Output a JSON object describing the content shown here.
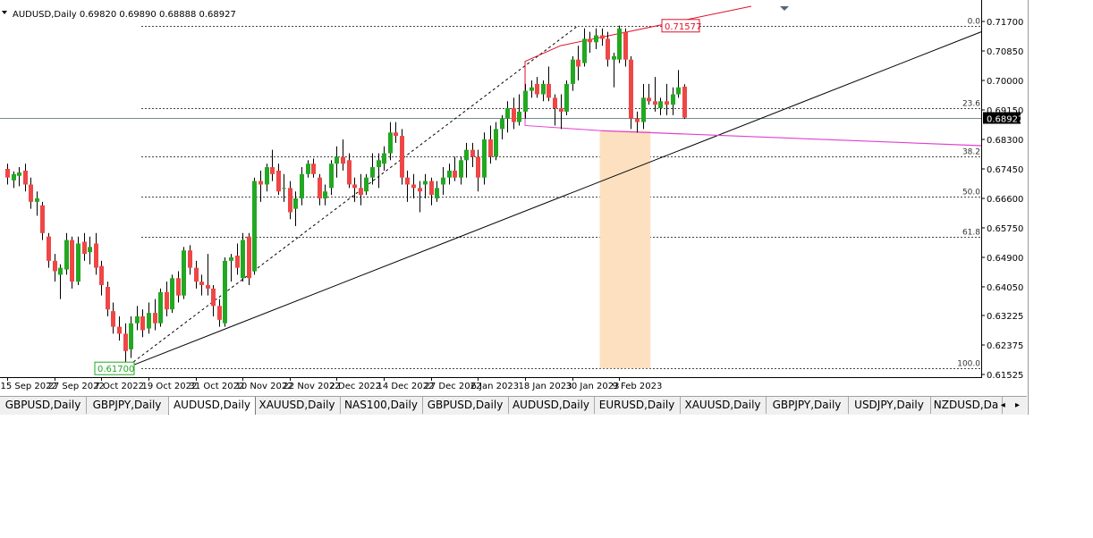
{
  "header": {
    "symbol_info": "AUDUSD,Daily  0.69820 0.69890 0.68888 0.68927"
  },
  "tabs": [
    {
      "label": "GBPUSD,Daily",
      "active": false
    },
    {
      "label": "GBPJPY,Daily",
      "active": false
    },
    {
      "label": "AUDUSD,Daily",
      "active": true
    },
    {
      "label": "XAUUSD,Daily",
      "active": false
    },
    {
      "label": "NAS100,Daily",
      "active": false
    },
    {
      "label": "GBPUSD,Daily",
      "active": false
    },
    {
      "label": "AUDUSD,Daily",
      "active": false
    },
    {
      "label": "EURUSD,Daily",
      "active": false
    },
    {
      "label": "XAUUSD,Daily",
      "active": false
    },
    {
      "label": "GBPJPY,Daily",
      "active": false
    },
    {
      "label": "USDJPY,Daily",
      "active": false
    },
    {
      "label": "NZDUSD,Da",
      "active": false
    }
  ],
  "tab_arrows": "◂ ▸",
  "colors": {
    "bull": "#22a822",
    "bear": "#ef4646",
    "fib": "#444444",
    "trendline": "#000000",
    "channel_red": "#e0102a",
    "magenta": "#e040d0",
    "zone": "#fde0bf",
    "price_line": "#6f8f8f"
  },
  "chart_data": {
    "type": "candlestick",
    "symbol": "AUDUSD",
    "timeframe": "Daily",
    "last_ohlc": {
      "open": 0.6982,
      "high": 0.6989,
      "low": 0.68888,
      "close": 0.68927
    },
    "current_price_label": "0.68927",
    "ylim": [
      0.613,
      0.721
    ],
    "y_ticks": [
      "0.71700",
      "0.70850",
      "0.70000",
      "0.69150",
      "0.68300",
      "0.67450",
      "0.66600",
      "0.65750",
      "0.64900",
      "0.64050",
      "0.63225",
      "0.62375",
      "0.61525"
    ],
    "x_ticks": [
      {
        "i": 0,
        "label": "15 Sep 2022"
      },
      {
        "i": 8,
        "label": "27 Sep 2022"
      },
      {
        "i": 16,
        "label": "7 Oct 2022"
      },
      {
        "i": 24,
        "label": "19 Oct 2022"
      },
      {
        "i": 32,
        "label": "31 Oct 2022"
      },
      {
        "i": 40,
        "label": "10 Nov 2022"
      },
      {
        "i": 48,
        "label": "22 Nov 2022"
      },
      {
        "i": 56,
        "label": "2 Dec 2022"
      },
      {
        "i": 64,
        "label": "14 Dec 2022"
      },
      {
        "i": 72,
        "label": "27 Dec 2022"
      },
      {
        "i": 80,
        "label": "6 Jan 2023"
      },
      {
        "i": 88,
        "label": "18 Jan 2023"
      },
      {
        "i": 96,
        "label": "30 Jan 2023"
      },
      {
        "i": 104,
        "label": "9 Feb 2023"
      }
    ],
    "fib_levels": [
      {
        "label": "0.0",
        "price": 0.71577
      },
      {
        "label": "23.6",
        "price": 0.692
      },
      {
        "label": "38.2",
        "price": 0.678
      },
      {
        "label": "50.0",
        "price": 0.6665
      },
      {
        "label": "61.8",
        "price": 0.655
      },
      {
        "label": "100.0",
        "price": 0.617
      }
    ],
    "annotations": {
      "swing_high": {
        "label": "0.71577",
        "price": 0.71577,
        "i": 95
      },
      "swing_low": {
        "label": "0.61700",
        "price": 0.617,
        "i": 20
      }
    },
    "candles": [
      {
        "o": 0.6745,
        "h": 0.676,
        "l": 0.67,
        "c": 0.672
      },
      {
        "o": 0.6712,
        "h": 0.6738,
        "l": 0.669,
        "c": 0.673
      },
      {
        "o": 0.6725,
        "h": 0.675,
        "l": 0.6695,
        "c": 0.6735
      },
      {
        "o": 0.674,
        "h": 0.676,
        "l": 0.668,
        "c": 0.67
      },
      {
        "o": 0.67,
        "h": 0.672,
        "l": 0.663,
        "c": 0.665
      },
      {
        "o": 0.665,
        "h": 0.668,
        "l": 0.661,
        "c": 0.666
      },
      {
        "o": 0.664,
        "h": 0.665,
        "l": 0.654,
        "c": 0.656
      },
      {
        "o": 0.655,
        "h": 0.656,
        "l": 0.646,
        "c": 0.648
      },
      {
        "o": 0.648,
        "h": 0.65,
        "l": 0.642,
        "c": 0.645
      },
      {
        "o": 0.644,
        "h": 0.647,
        "l": 0.637,
        "c": 0.646
      },
      {
        "o": 0.6455,
        "h": 0.656,
        "l": 0.644,
        "c": 0.654
      },
      {
        "o": 0.654,
        "h": 0.655,
        "l": 0.64,
        "c": 0.642
      },
      {
        "o": 0.642,
        "h": 0.655,
        "l": 0.641,
        "c": 0.653
      },
      {
        "o": 0.6535,
        "h": 0.656,
        "l": 0.648,
        "c": 0.65
      },
      {
        "o": 0.6505,
        "h": 0.655,
        "l": 0.647,
        "c": 0.652
      },
      {
        "o": 0.653,
        "h": 0.656,
        "l": 0.644,
        "c": 0.646
      },
      {
        "o": 0.6465,
        "h": 0.648,
        "l": 0.638,
        "c": 0.641
      },
      {
        "o": 0.6405,
        "h": 0.642,
        "l": 0.632,
        "c": 0.634
      },
      {
        "o": 0.6335,
        "h": 0.636,
        "l": 0.627,
        "c": 0.629
      },
      {
        "o": 0.629,
        "h": 0.632,
        "l": 0.625,
        "c": 0.627
      },
      {
        "o": 0.627,
        "h": 0.63,
        "l": 0.617,
        "c": 0.622
      },
      {
        "o": 0.6225,
        "h": 0.632,
        "l": 0.62,
        "c": 0.63
      },
      {
        "o": 0.63,
        "h": 0.635,
        "l": 0.628,
        "c": 0.632
      },
      {
        "o": 0.632,
        "h": 0.634,
        "l": 0.626,
        "c": 0.628
      },
      {
        "o": 0.6285,
        "h": 0.636,
        "l": 0.627,
        "c": 0.633
      },
      {
        "o": 0.633,
        "h": 0.637,
        "l": 0.628,
        "c": 0.63
      },
      {
        "o": 0.63,
        "h": 0.64,
        "l": 0.629,
        "c": 0.639
      },
      {
        "o": 0.639,
        "h": 0.642,
        "l": 0.632,
        "c": 0.634
      },
      {
        "o": 0.634,
        "h": 0.644,
        "l": 0.633,
        "c": 0.643
      },
      {
        "o": 0.643,
        "h": 0.645,
        "l": 0.636,
        "c": 0.638
      },
      {
        "o": 0.638,
        "h": 0.652,
        "l": 0.637,
        "c": 0.651
      },
      {
        "o": 0.651,
        "h": 0.6525,
        "l": 0.644,
        "c": 0.646
      },
      {
        "o": 0.646,
        "h": 0.648,
        "l": 0.64,
        "c": 0.642
      },
      {
        "o": 0.642,
        "h": 0.644,
        "l": 0.638,
        "c": 0.641
      },
      {
        "o": 0.641,
        "h": 0.65,
        "l": 0.638,
        "c": 0.64
      },
      {
        "o": 0.64,
        "h": 0.641,
        "l": 0.632,
        "c": 0.635
      },
      {
        "o": 0.635,
        "h": 0.637,
        "l": 0.629,
        "c": 0.631
      },
      {
        "o": 0.63,
        "h": 0.649,
        "l": 0.629,
        "c": 0.648
      },
      {
        "o": 0.648,
        "h": 0.65,
        "l": 0.642,
        "c": 0.649
      },
      {
        "o": 0.6495,
        "h": 0.653,
        "l": 0.644,
        "c": 0.646
      },
      {
        "o": 0.643,
        "h": 0.656,
        "l": 0.642,
        "c": 0.654
      },
      {
        "o": 0.655,
        "h": 0.656,
        "l": 0.641,
        "c": 0.643
      },
      {
        "o": 0.645,
        "h": 0.672,
        "l": 0.644,
        "c": 0.671
      },
      {
        "o": 0.671,
        "h": 0.674,
        "l": 0.665,
        "c": 0.67
      },
      {
        "o": 0.67,
        "h": 0.676,
        "l": 0.668,
        "c": 0.675
      },
      {
        "o": 0.675,
        "h": 0.68,
        "l": 0.671,
        "c": 0.673
      },
      {
        "o": 0.674,
        "h": 0.676,
        "l": 0.667,
        "c": 0.668
      },
      {
        "o": 0.669,
        "h": 0.673,
        "l": 0.665,
        "c": 0.669
      },
      {
        "o": 0.669,
        "h": 0.671,
        "l": 0.66,
        "c": 0.662
      },
      {
        "o": 0.663,
        "h": 0.668,
        "l": 0.658,
        "c": 0.666
      },
      {
        "o": 0.666,
        "h": 0.675,
        "l": 0.664,
        "c": 0.673
      },
      {
        "o": 0.673,
        "h": 0.677,
        "l": 0.672,
        "c": 0.676
      },
      {
        "o": 0.676,
        "h": 0.6775,
        "l": 0.672,
        "c": 0.673
      },
      {
        "o": 0.672,
        "h": 0.673,
        "l": 0.664,
        "c": 0.666
      },
      {
        "o": 0.666,
        "h": 0.67,
        "l": 0.664,
        "c": 0.668
      },
      {
        "o": 0.669,
        "h": 0.677,
        "l": 0.667,
        "c": 0.676
      },
      {
        "o": 0.676,
        "h": 0.681,
        "l": 0.672,
        "c": 0.678
      },
      {
        "o": 0.678,
        "h": 0.683,
        "l": 0.674,
        "c": 0.676
      },
      {
        "o": 0.677,
        "h": 0.679,
        "l": 0.669,
        "c": 0.67
      },
      {
        "o": 0.67,
        "h": 0.672,
        "l": 0.665,
        "c": 0.669
      },
      {
        "o": 0.669,
        "h": 0.673,
        "l": 0.664,
        "c": 0.667
      },
      {
        "o": 0.668,
        "h": 0.673,
        "l": 0.667,
        "c": 0.672
      },
      {
        "o": 0.672,
        "h": 0.679,
        "l": 0.67,
        "c": 0.675
      },
      {
        "o": 0.675,
        "h": 0.679,
        "l": 0.669,
        "c": 0.677
      },
      {
        "o": 0.676,
        "h": 0.681,
        "l": 0.674,
        "c": 0.679
      },
      {
        "o": 0.679,
        "h": 0.688,
        "l": 0.677,
        "c": 0.685
      },
      {
        "o": 0.685,
        "h": 0.688,
        "l": 0.682,
        "c": 0.684
      },
      {
        "o": 0.684,
        "h": 0.686,
        "l": 0.67,
        "c": 0.672
      },
      {
        "o": 0.672,
        "h": 0.674,
        "l": 0.665,
        "c": 0.67
      },
      {
        "o": 0.67,
        "h": 0.673,
        "l": 0.666,
        "c": 0.669
      },
      {
        "o": 0.669,
        "h": 0.671,
        "l": 0.662,
        "c": 0.668
      },
      {
        "o": 0.67,
        "h": 0.673,
        "l": 0.666,
        "c": 0.671
      },
      {
        "o": 0.671,
        "h": 0.672,
        "l": 0.664,
        "c": 0.667
      },
      {
        "o": 0.666,
        "h": 0.671,
        "l": 0.665,
        "c": 0.669
      },
      {
        "o": 0.67,
        "h": 0.675,
        "l": 0.667,
        "c": 0.672
      },
      {
        "o": 0.672,
        "h": 0.676,
        "l": 0.67,
        "c": 0.674
      },
      {
        "o": 0.674,
        "h": 0.678,
        "l": 0.671,
        "c": 0.672
      },
      {
        "o": 0.672,
        "h": 0.678,
        "l": 0.67,
        "c": 0.677
      },
      {
        "o": 0.677,
        "h": 0.682,
        "l": 0.672,
        "c": 0.68
      },
      {
        "o": 0.68,
        "h": 0.682,
        "l": 0.675,
        "c": 0.678
      },
      {
        "o": 0.678,
        "h": 0.68,
        "l": 0.668,
        "c": 0.672
      },
      {
        "o": 0.672,
        "h": 0.685,
        "l": 0.67,
        "c": 0.683
      },
      {
        "o": 0.683,
        "h": 0.687,
        "l": 0.676,
        "c": 0.678
      },
      {
        "o": 0.678,
        "h": 0.688,
        "l": 0.677,
        "c": 0.686
      },
      {
        "o": 0.686,
        "h": 0.69,
        "l": 0.683,
        "c": 0.689
      },
      {
        "o": 0.689,
        "h": 0.694,
        "l": 0.685,
        "c": 0.692
      },
      {
        "o": 0.692,
        "h": 0.695,
        "l": 0.686,
        "c": 0.688
      },
      {
        "o": 0.688,
        "h": 0.696,
        "l": 0.687,
        "c": 0.691
      },
      {
        "o": 0.691,
        "h": 0.699,
        "l": 0.689,
        "c": 0.697
      },
      {
        "o": 0.697,
        "h": 0.7,
        "l": 0.695,
        "c": 0.698
      },
      {
        "o": 0.699,
        "h": 0.701,
        "l": 0.695,
        "c": 0.696
      },
      {
        "o": 0.696,
        "h": 0.7,
        "l": 0.694,
        "c": 0.699
      },
      {
        "o": 0.699,
        "h": 0.704,
        "l": 0.694,
        "c": 0.695
      },
      {
        "o": 0.695,
        "h": 0.696,
        "l": 0.687,
        "c": 0.692
      },
      {
        "o": 0.692,
        "h": 0.696,
        "l": 0.686,
        "c": 0.691
      },
      {
        "o": 0.691,
        "h": 0.7,
        "l": 0.69,
        "c": 0.699
      },
      {
        "o": 0.699,
        "h": 0.707,
        "l": 0.697,
        "c": 0.706
      },
      {
        "o": 0.706,
        "h": 0.71,
        "l": 0.7,
        "c": 0.704
      },
      {
        "o": 0.705,
        "h": 0.715,
        "l": 0.704,
        "c": 0.712
      },
      {
        "o": 0.712,
        "h": 0.714,
        "l": 0.708,
        "c": 0.711
      },
      {
        "o": 0.711,
        "h": 0.715,
        "l": 0.709,
        "c": 0.713
      },
      {
        "o": 0.713,
        "h": 0.715,
        "l": 0.71,
        "c": 0.712
      },
      {
        "o": 0.712,
        "h": 0.714,
        "l": 0.704,
        "c": 0.706
      },
      {
        "o": 0.706,
        "h": 0.708,
        "l": 0.698,
        "c": 0.707
      },
      {
        "o": 0.706,
        "h": 0.7158,
        "l": 0.705,
        "c": 0.715
      },
      {
        "o": 0.714,
        "h": 0.715,
        "l": 0.704,
        "c": 0.706
      },
      {
        "o": 0.706,
        "h": 0.707,
        "l": 0.686,
        "c": 0.689
      },
      {
        "o": 0.689,
        "h": 0.691,
        "l": 0.685,
        "c": 0.688
      },
      {
        "o": 0.688,
        "h": 0.699,
        "l": 0.686,
        "c": 0.695
      },
      {
        "o": 0.695,
        "h": 0.699,
        "l": 0.693,
        "c": 0.694
      },
      {
        "o": 0.694,
        "h": 0.701,
        "l": 0.691,
        "c": 0.693
      },
      {
        "o": 0.692,
        "h": 0.695,
        "l": 0.69,
        "c": 0.694
      },
      {
        "o": 0.694,
        "h": 0.699,
        "l": 0.69,
        "c": 0.693
      },
      {
        "o": 0.693,
        "h": 0.698,
        "l": 0.69,
        "c": 0.696
      },
      {
        "o": 0.696,
        "h": 0.703,
        "l": 0.695,
        "c": 0.698
      },
      {
        "o": 0.6982,
        "h": 0.6989,
        "l": 0.68888,
        "c": 0.68927
      }
    ]
  }
}
